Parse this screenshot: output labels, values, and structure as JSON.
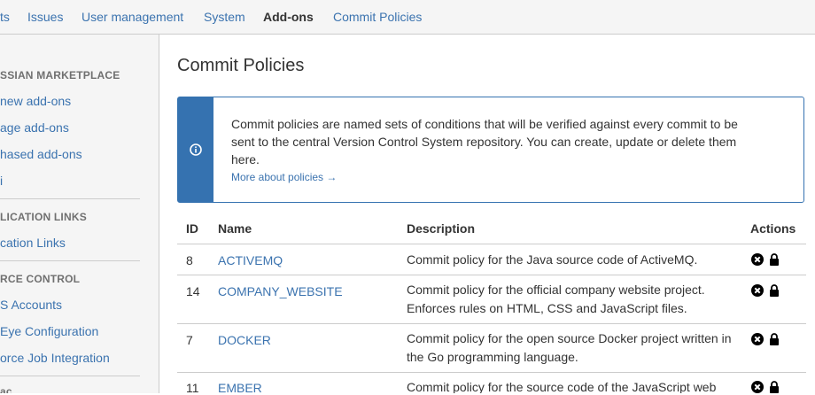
{
  "topnav": {
    "tabs": [
      {
        "label": "ts"
      },
      {
        "label": "Issues"
      },
      {
        "label": "User management"
      },
      {
        "label": "System"
      },
      {
        "label": "Add-ons",
        "active": true
      },
      {
        "label": "Commit Policies"
      }
    ]
  },
  "sidebar": {
    "sections": [
      {
        "header": "SSIAN MARKETPLACE",
        "items": [
          "new add-ons",
          "age add-ons",
          "hased add-ons",
          "i"
        ]
      },
      {
        "header": "LICATION LINKS",
        "items": [
          "cation Links"
        ]
      },
      {
        "header": "RCE CONTROL",
        "items": [
          "S Accounts",
          "Eye Configuration",
          "orce Job Integration"
        ]
      }
    ],
    "cutoff_text": "ac"
  },
  "page": {
    "title": "Commit Policies"
  },
  "info": {
    "text": "Commit policies are named sets of conditions that will be verified against every commit to be sent to the central Version Control System repository. You can create, update or delete them here.",
    "link": "More about policies →",
    "icon": "info-circle-icon",
    "color": "#3572b0"
  },
  "table": {
    "headers": {
      "id": "ID",
      "name": "Name",
      "description": "Description",
      "actions": "Actions"
    },
    "rows": [
      {
        "id": "8",
        "name": "ACTIVEMQ",
        "description": "Commit policy for the Java source code of ActiveMQ."
      },
      {
        "id": "14",
        "name": "COMPANY_WEBSITE",
        "description": "Commit policy for the official company website project. Enforces rules on HTML, CSS and JavaScript files."
      },
      {
        "id": "7",
        "name": "DOCKER",
        "description": "Commit policy for the open source Docker project written in the Go programming language."
      },
      {
        "id": "11",
        "name": "EMBER",
        "description": "Commit policy for the source code of the JavaScript web"
      }
    ],
    "action_icons": [
      "delete-circle-icon",
      "lock-icon"
    ]
  }
}
